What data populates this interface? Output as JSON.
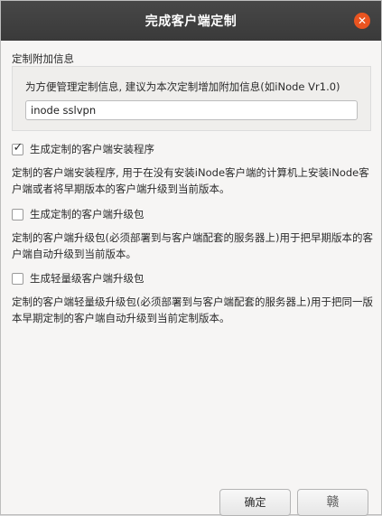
{
  "window": {
    "title": "完成客户端定制",
    "close_icon": "close-icon"
  },
  "extra_info": {
    "section_label": "定制附加信息",
    "hint": "为方便管理定制信息, 建议为本次定制增加附加信息(如iNode Vr1.0)",
    "input_value": "inode sslvpn"
  },
  "options": [
    {
      "label": "生成定制的客户端安装程序",
      "checked": true,
      "description": "定制的客户端安装程序, 用于在没有安装iNode客户端的计算机上安装iNode客户端或者将早期版本的客户端升级到当前版本。"
    },
    {
      "label": "生成定制的客户端升级包",
      "checked": false,
      "description": "定制的客户端升级包(必须部署到与客户端配套的服务器上)用于把早期版本的客户端自动升级到当前版本。"
    },
    {
      "label": "生成轻量级客户端升级包",
      "checked": false,
      "description": "定制的客户端轻量级升级包(必须部署到与客户端配套的服务器上)用于把同一版本早期定制的客户端自动升级到当前定制版本。"
    }
  ],
  "buttons": {
    "ok_label": "确定",
    "cancel_label": "赣"
  },
  "colors": {
    "titlebar": "#3c3c3c",
    "close_button": "#e95420",
    "background": "#f6f5f4"
  }
}
